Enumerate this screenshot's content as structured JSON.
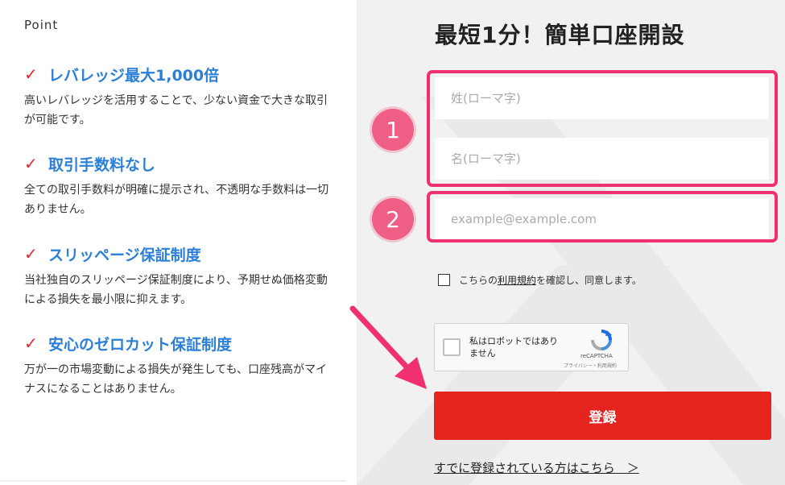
{
  "left": {
    "point_label": "Point",
    "features": [
      {
        "title": "レバレッジ最大1,000倍",
        "desc": "高いレバレッジを活用することで、少ない資金で大きな取引が可能です。"
      },
      {
        "title": "取引手数料なし",
        "desc": "全ての取引手数料が明確に提示され、不透明な手数料は一切ありません。"
      },
      {
        "title": "スリッページ保証制度",
        "desc": "当社独自のスリッページ保証制度により、予期せぬ価格変動による損失を最小限に抑えます。"
      },
      {
        "title": "安心のゼロカット保証制度",
        "desc": "万が一の市場変動による損失が発生しても、口座残高がマイナスになることはありません。"
      }
    ],
    "check_glyph": "✓"
  },
  "form": {
    "title": "最短1分！簡単口座開設",
    "last_name_placeholder": "姓(ローマ字)",
    "first_name_placeholder": "名(ローマ字)",
    "email_placeholder": "example@example.com",
    "badge1": "1",
    "badge2": "2",
    "terms_prefix": "こちらの",
    "terms_link": "利用規約",
    "terms_suffix": "を確認し、同意します。",
    "captcha_text": "私はロボットではありません",
    "captcha_brand": "reCAPTCHA",
    "captcha_links": "プライバシー・利用規約",
    "submit_label": "登録",
    "login_link": "すでに登録されている方はこちら　＞"
  },
  "colors": {
    "accent_red": "#e52420",
    "highlight_pink": "#f0306f",
    "feature_blue": "#2b7fd8"
  }
}
